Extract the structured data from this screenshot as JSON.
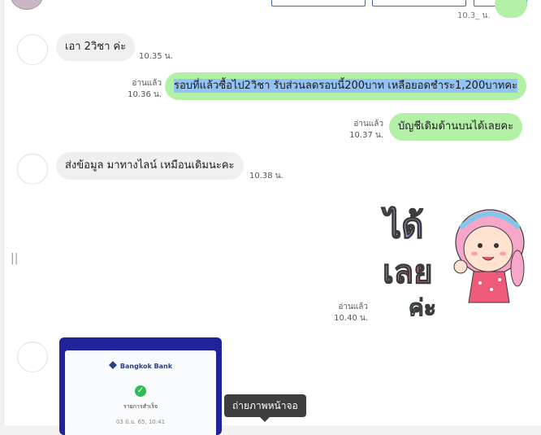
{
  "colors": {
    "incoming_bubble": "#efefef",
    "outgoing_bubble": "#b2f0a6",
    "selection_highlight": "#93c3f5",
    "tooltip_bg": "#3e3e3e",
    "bank_frame": "#20239a"
  },
  "header": {
    "partial_time": "10.3_ น."
  },
  "messages": [
    {
      "direction": "in",
      "text": "เอา 2วิชา ค่ะ",
      "time": "10.35 น."
    },
    {
      "direction": "out",
      "read": "อ่านแล้ว",
      "time": "10.36 น.",
      "text": "รอบที่แล้วซื้อไป2วิชา รับส่วนลดรอบนี้200บาท เหลือยอดชำระ1,200บาทคะ"
    },
    {
      "direction": "out",
      "read": "อ่านแล้ว",
      "time": "10.37 น.",
      "text": "บัญชีเดิมด้านบนได้เลยคะ"
    },
    {
      "direction": "in",
      "text": "ส่งข้อมูล มาทางไลน์ เหมือนเดิมนะคะ",
      "time": "10.38 น."
    },
    {
      "direction": "out",
      "type": "sticker",
      "read": "อ่านแล้ว",
      "time": "10.40 น.",
      "sticker_text": [
        "ได้",
        "เลย",
        "ค่ะ"
      ]
    },
    {
      "direction": "in",
      "type": "image",
      "bank_name": "Bangkok Bank",
      "status": "รายการสำเร็จ",
      "date": "03 มิ.ย. 65, 10:41"
    }
  ],
  "tooltip": {
    "text": "ถ่ายภาพหน้าจอ"
  },
  "handle_glyph": "||"
}
